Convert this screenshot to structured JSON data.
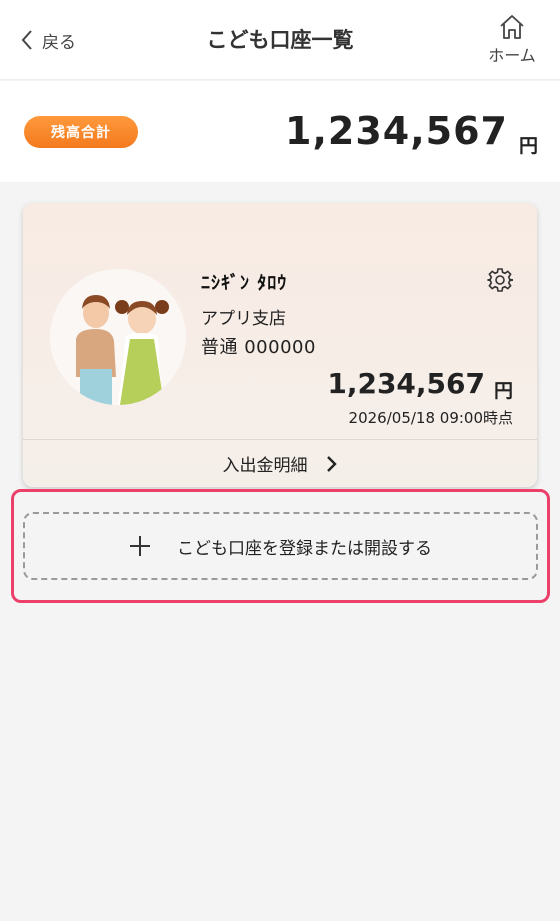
{
  "header": {
    "back_label": "戻る",
    "title": "こども口座一覧",
    "home_label": "ホーム"
  },
  "balance": {
    "badge": "残高合計",
    "amount": "1,234,567",
    "unit": "円"
  },
  "account": {
    "name": "ﾆｼｷﾞﾝ ﾀﾛｳ",
    "branch": "アプリ支店",
    "number": "普通 000000",
    "amount": "1,234,567",
    "unit": "円",
    "as_of": "2026/05/18 09:00時点",
    "history_link": "入出金明細"
  },
  "register": {
    "label": "こども口座を登録または開設する"
  },
  "colors": {
    "badge_orange": "#f47a1f",
    "highlight_pink": "#ec3f6a",
    "card_bg": "#f8ebe3"
  },
  "icons": {
    "back": "chevron-left-icon",
    "home": "home-icon",
    "settings": "gear-icon",
    "history_arrow": "chevron-right-icon",
    "add": "plus-icon"
  }
}
